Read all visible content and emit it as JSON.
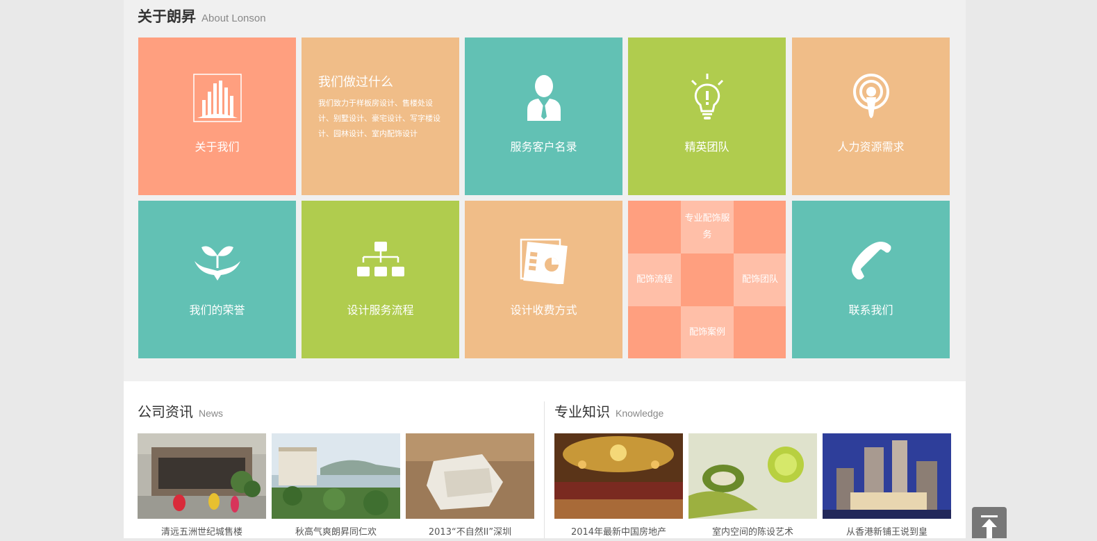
{
  "about": {
    "title_cn": "关于朗昇",
    "title_en": "About Lonson"
  },
  "tiles": {
    "about_us": "关于我们",
    "what_we_did_title": "我们做过什么",
    "what_we_did_desc": "我们致力于样板房设计、售楼处设计、别墅设计、豪宅设计、写字楼设计、园林设计、室内配饰设计",
    "clients": "服务客户名录",
    "team": "精英团队",
    "hr": "人力资源需求",
    "honors": "我们的荣誉",
    "process": "设计服务流程",
    "fees": "设计收费方式",
    "contact": "联系我们"
  },
  "mosaic": {
    "top": "专业配饰服务",
    "left": "配饰流程",
    "right": "配饰团队",
    "bottom": "配饰案例"
  },
  "colors": {
    "salmon": "#ff9f7f",
    "peach": "#f0bd88",
    "teal": "#62c1b4",
    "green": "#b0cc4e",
    "light_salmon": "#ffbfa8"
  },
  "news": {
    "title_cn": "公司资讯",
    "title_en": "News",
    "items": [
      "清远五洲世纪城售楼",
      "秋高气爽朗昇同仁欢",
      "2013“不自然II”深圳"
    ]
  },
  "knowledge": {
    "title_cn": "专业知识",
    "title_en": "Knowledge",
    "items": [
      "2014年最新中国房地产",
      "室内空间的陈设艺术",
      "从香港新铺王说到皇"
    ]
  },
  "icons": [
    "building-icon",
    "client-icon",
    "lightbulb-icon",
    "broadcast-icon",
    "sprout-icon",
    "org-chart-icon",
    "report-icon",
    "phone-icon",
    "back-to-top-icon"
  ]
}
